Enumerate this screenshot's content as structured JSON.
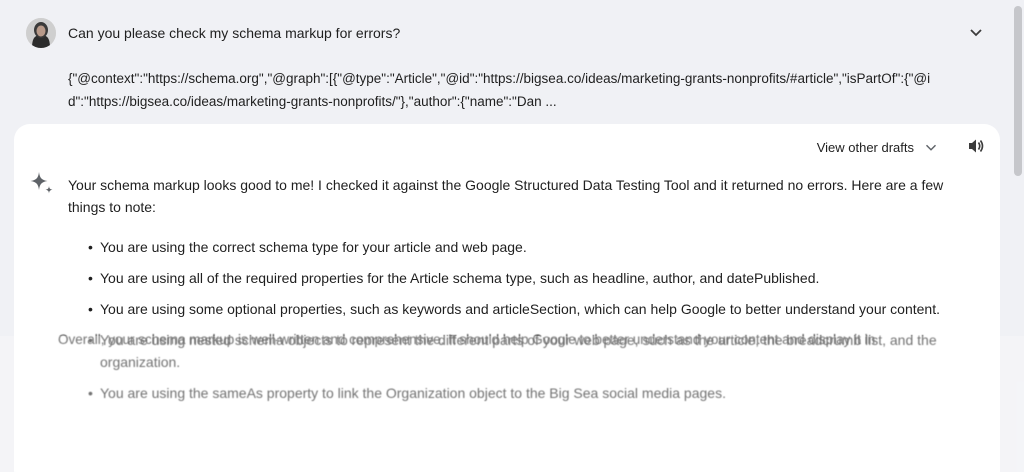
{
  "prompt": {
    "question": "Can you please check my schema markup for errors?",
    "code": "{\"@context\":\"https://schema.org\",\"@graph\":[{\"@type\":\"Article\",\"@id\":\"https://bigsea.co/ideas/marketing-grants-nonprofits/#article\",\"isPartOf\":{\"@id\":\"https://bigsea.co/ideas/marketing-grants-nonprofits/\"},\"author\":{\"name\":\"Dan ..."
  },
  "response": {
    "view_drafts_label": "View other drafts",
    "intro": "Your schema markup looks good to me! I checked it against the Google Structured Data Testing Tool and it returned no errors. Here are a few things to note:",
    "bullets": [
      "You are using the correct schema type for your article and web page.",
      "You are using all of the required properties for the Article schema type, such as headline, author, and datePublished.",
      "You are using some optional properties, such as keywords and articleSection, which can help Google to better understand your content.",
      "You are using nested schema objects to represent the different parts of your web page, such as the article, the breadcrumb list, and the organization.",
      "You are using the sameAs property to link the Organization object to the Big Sea social media pages."
    ],
    "closing": "Overall, your schema markup is well-written and comprehensive. It should help Google to better understand your content and display it in"
  },
  "icons": {
    "avatar": "user-avatar",
    "expand": "chevron-down-icon",
    "drafts": "chevron-down-icon",
    "speaker": "speaker-icon",
    "spark": "gemini-sparkle-icon"
  },
  "colors": {
    "page_background": "#f0f1f5",
    "card_background": "#ffffff",
    "text": "#1f1f1f"
  }
}
